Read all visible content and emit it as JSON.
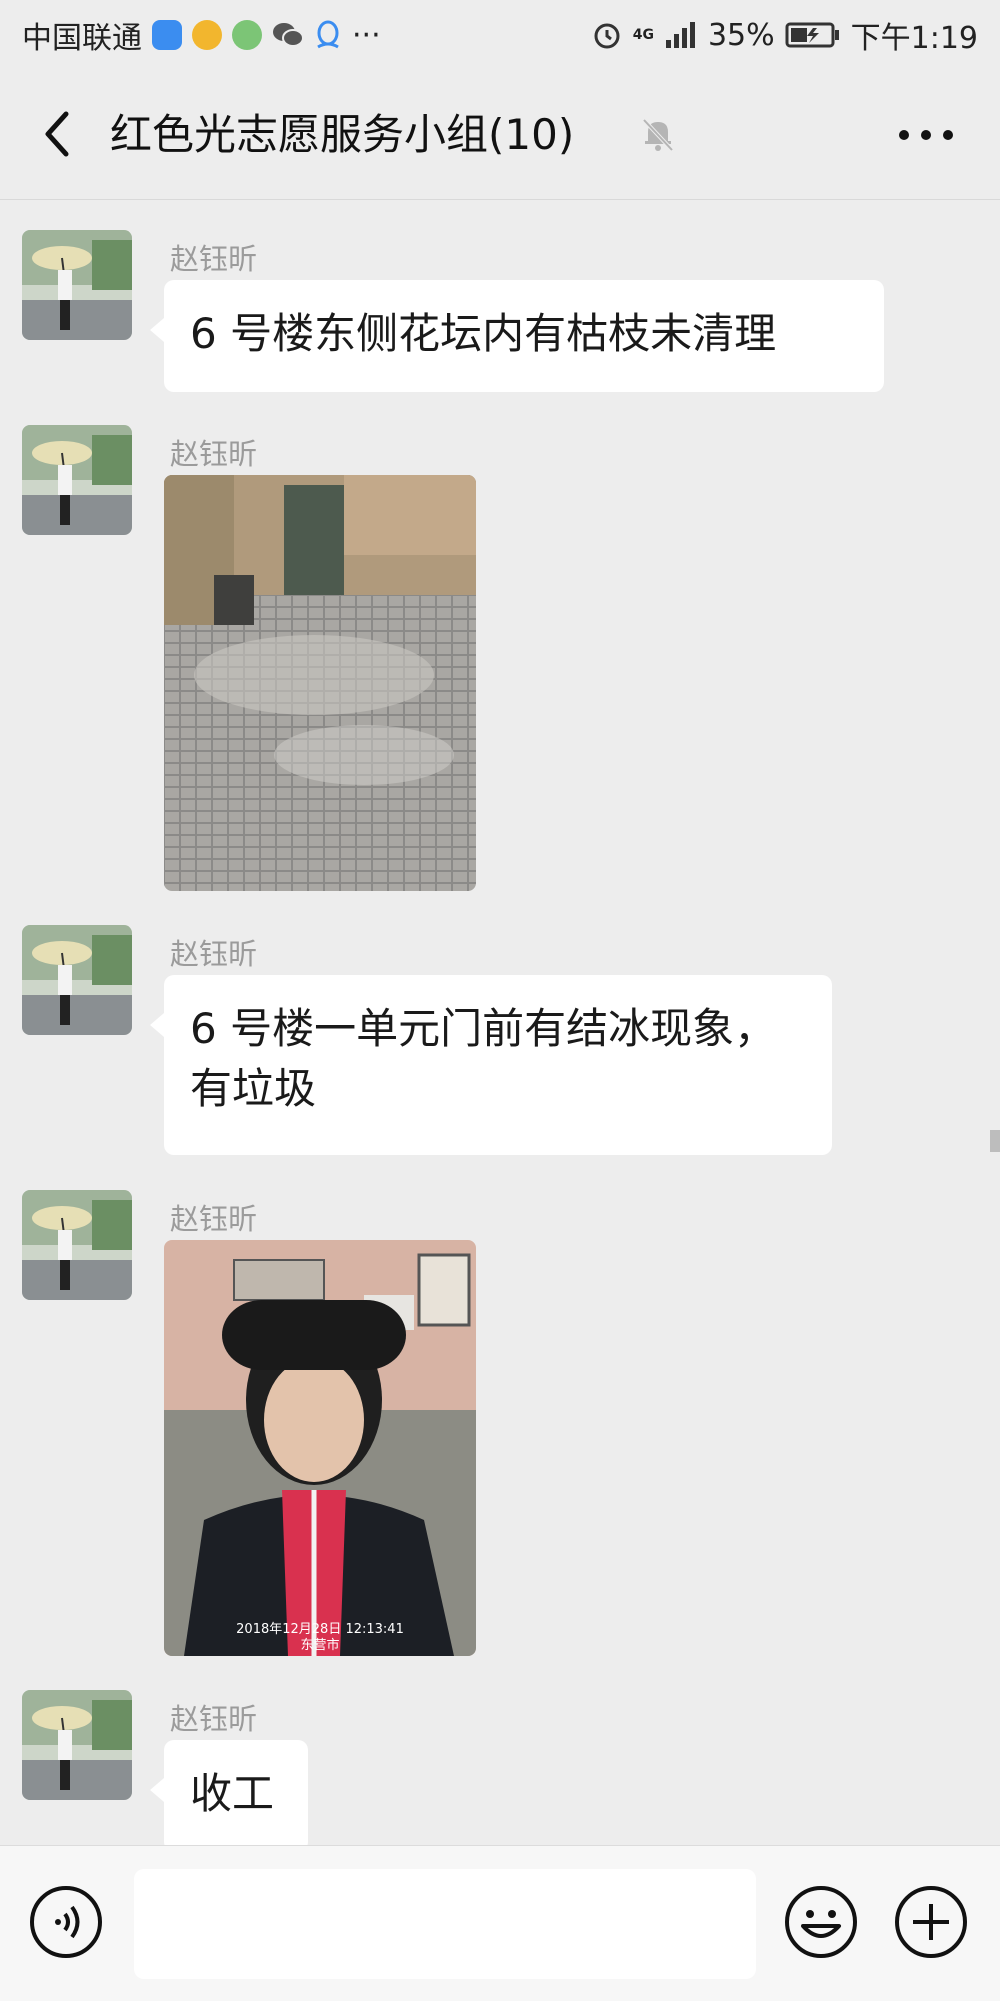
{
  "status_bar": {
    "carrier": "中国联通",
    "more_indicator": "···",
    "network": "4G",
    "battery": "35%",
    "time": "下午1:19"
  },
  "chat": {
    "title": "红色光志愿服务小组(10)",
    "muted": true
  },
  "messages": [
    {
      "sender": "赵钰昕",
      "type": "text",
      "text": "6 号楼东侧花坛内有枯枝未清理"
    },
    {
      "sender": "赵钰昕",
      "type": "image",
      "image_desc": "pavement-photo",
      "caption": ""
    },
    {
      "sender": "赵钰昕",
      "type": "text",
      "text": "6 号楼一单元门前有结冰现象，有垃圾"
    },
    {
      "sender": "赵钰昕",
      "type": "image",
      "image_desc": "selfie-photo",
      "watermark": "2018年12月28日 12:13:41",
      "location": "东营市"
    },
    {
      "sender": "赵钰昕",
      "type": "text",
      "text": "收工"
    }
  ],
  "input": {
    "placeholder": ""
  },
  "colors": {
    "background": "#ededed",
    "bubble": "#ffffff",
    "sender_name": "#9b9b9b"
  }
}
